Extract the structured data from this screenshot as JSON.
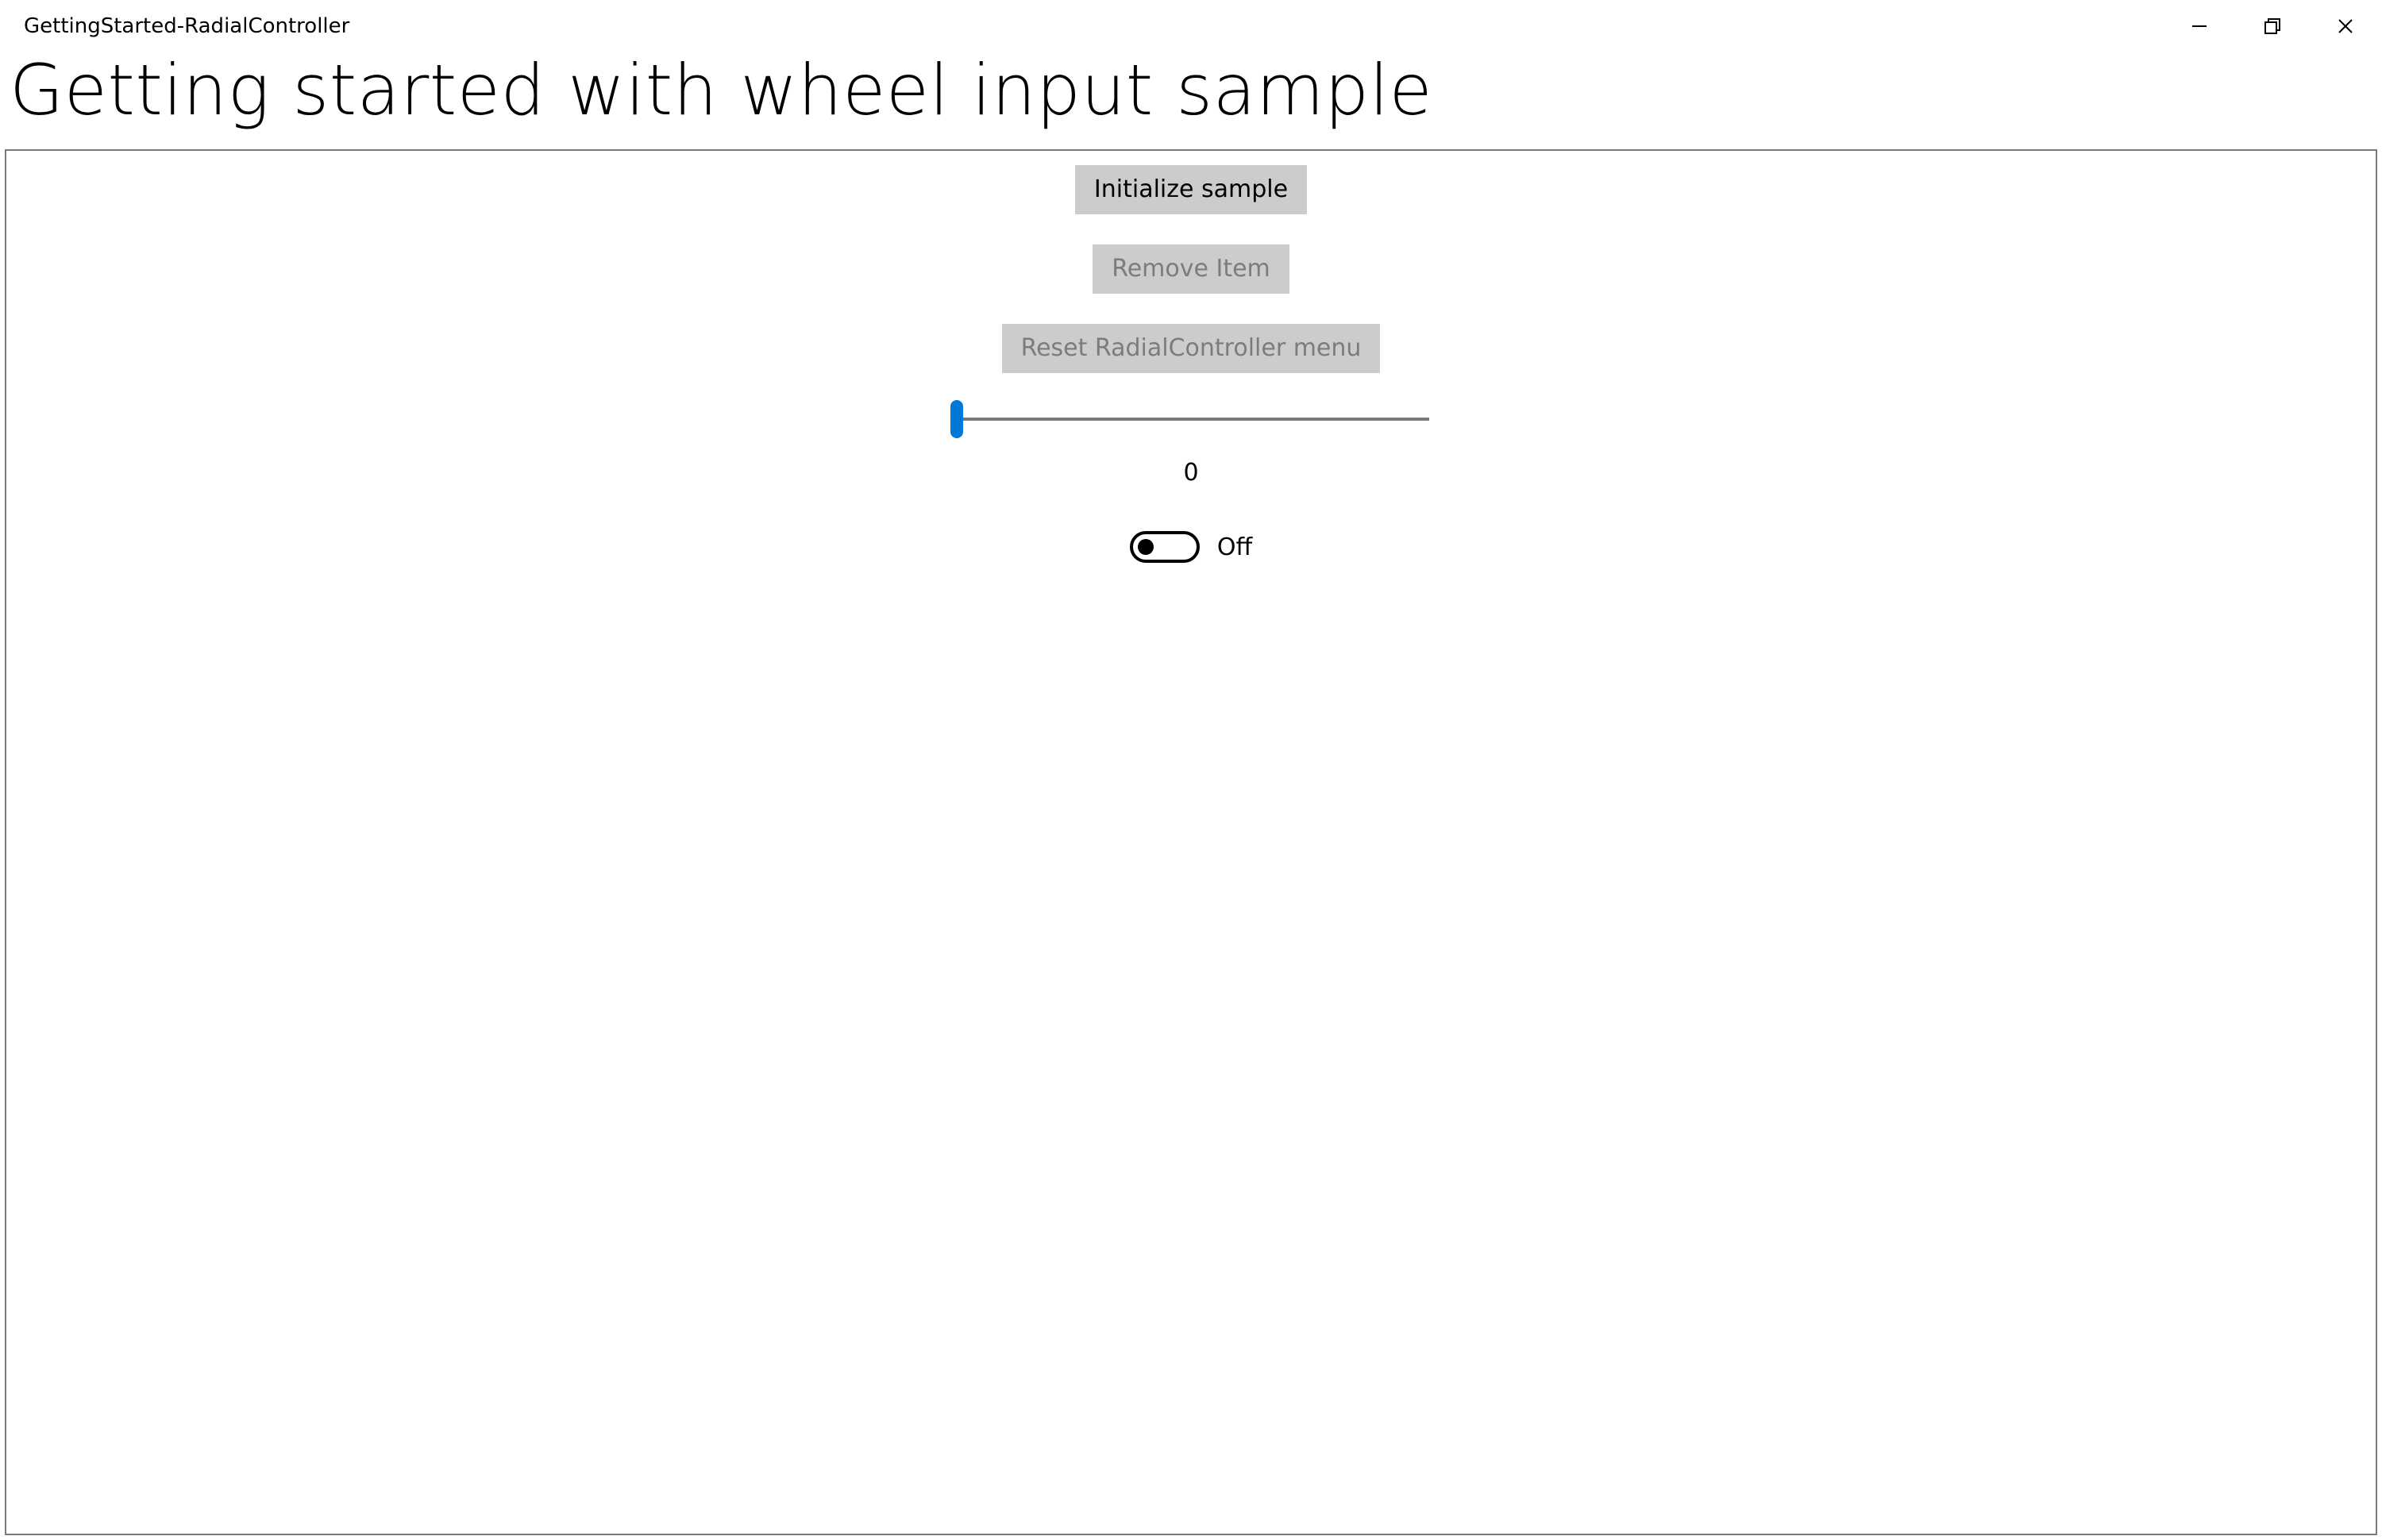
{
  "window": {
    "title": "GettingStarted-RadialController"
  },
  "heading": "Getting started with wheel input sample",
  "buttons": {
    "initialize": "Initialize sample",
    "remove": "Remove Item",
    "reset": "Reset RadialController menu"
  },
  "slider": {
    "value_display": "0"
  },
  "toggle": {
    "state_label": "Off"
  }
}
